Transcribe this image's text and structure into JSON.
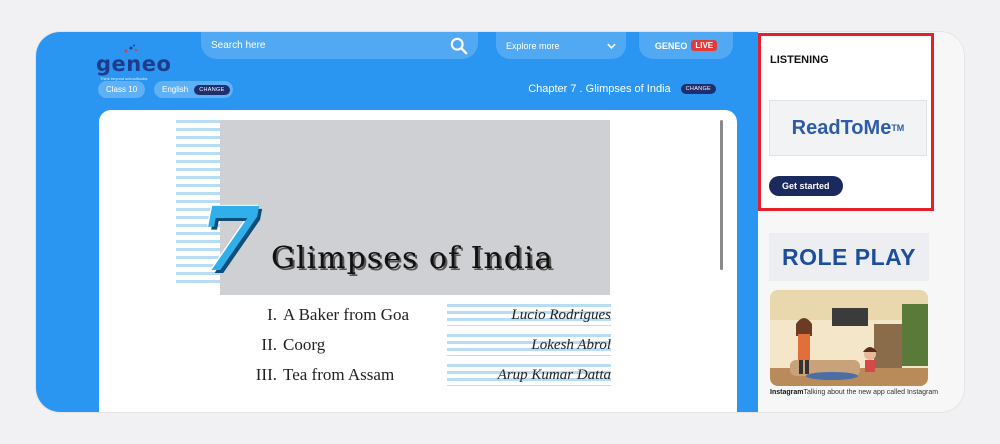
{
  "logo": {
    "wordmark": "geneo",
    "tagline": "Think beyond schoolbooks"
  },
  "header": {
    "search_placeholder": "Search here",
    "explore_label": "Explore more",
    "live_brand": "GENEO",
    "live_badge": "LIVE"
  },
  "filters": {
    "class_label": "Class 10",
    "language_label": "English",
    "change_label": "CHANGE"
  },
  "chapter": {
    "label": "Chapter 7 . Glimpses of India",
    "change_label": "CHANGE"
  },
  "book": {
    "chapter_number": "7",
    "chapter_title": "Glimpses of India",
    "toc": [
      {
        "num": "I.",
        "title": "A Baker from Goa",
        "author": "Lucio Rodrigues"
      },
      {
        "num": "II.",
        "title": "Coorg",
        "author": "Lokesh Abrol"
      },
      {
        "num": "III.",
        "title": "Tea from Assam",
        "author": "Arup Kumar Datta"
      }
    ]
  },
  "sidebar": {
    "listening_title": "LISTENING",
    "readtome_label": "ReadToMe",
    "readtome_tm": "TM",
    "get_started_label": "Get started",
    "roleplay_title": "ROLE PLAY",
    "video_title": "Instagram",
    "video_desc": "Talking about the new app called Instagram"
  },
  "colors": {
    "main_bg": "#2b96f2",
    "highlight_border": "#e5202b",
    "button_dark": "#1a2a5e",
    "live_red": "#e23a3a",
    "seven_blue": "#2fb0ea"
  },
  "icons": [
    "search-icon",
    "chevron-down-icon",
    "logo-dots-icon"
  ]
}
